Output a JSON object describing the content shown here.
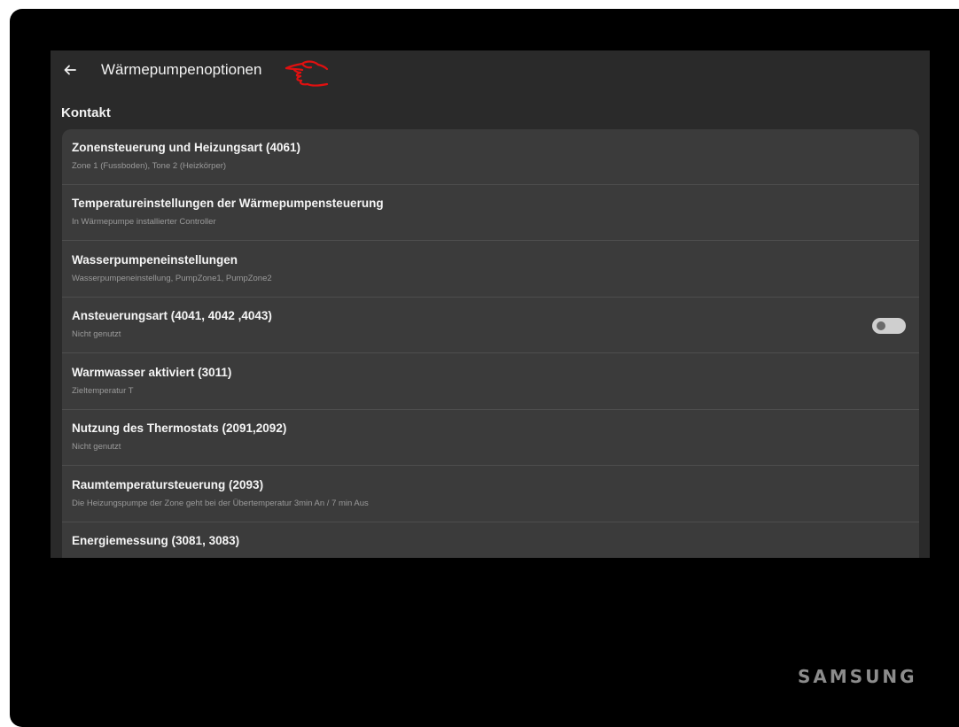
{
  "appbar": {
    "title": "Wärmepumpenoptionen"
  },
  "section": {
    "label": "Kontakt"
  },
  "items": [
    {
      "title": "Zonensteuerung und Heizungsart (4061)",
      "subtitle": "Zone 1 (Fussboden), Tone 2 (Heizkörper)"
    },
    {
      "title": "Temperatureinstellungen der Wärmepumpensteuerung",
      "subtitle": "In Wärmepumpe installierter Controller"
    },
    {
      "title": "Wasserpumpeneinstellungen",
      "subtitle": "Wasserpumpeneinstellung, PumpZone1, PumpZone2"
    },
    {
      "title": "Ansteuerungsart (4041, 4042 ,4043)",
      "subtitle": "Nicht genutzt",
      "toggle": false
    },
    {
      "title": "Warmwasser aktiviert (3011)",
      "subtitle": "Zieltemperatur T"
    },
    {
      "title": "Nutzung des Thermostats (2091,2092)",
      "subtitle": "Nicht genutzt"
    },
    {
      "title": "Raumtemperatursteuerung (2093)",
      "subtitle": "Die Heizungspumpe der Zone geht bei der Übertemperatur 3min An / 7 min Aus"
    },
    {
      "title": "Energiemessung (3081, 3083)",
      "subtitle": ""
    }
  ],
  "device": {
    "brand": "SAMSUNG"
  },
  "colors": {
    "screen_bg": "#2a2a2a",
    "card_bg": "#3b3b3b",
    "annotation": "#e01010"
  }
}
